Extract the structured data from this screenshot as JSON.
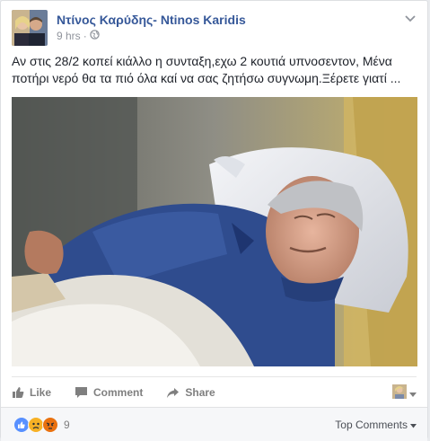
{
  "post": {
    "author": "Ντίνος Καρύδης- Ntinos Karidis",
    "time": "9 hrs",
    "time_separator": "·",
    "privacy_icon": "globe-icon",
    "text": "Αν στις 28/2 κοπεί κιάλλο η συνταξη,εχω 2 κουτιά υπνοσεντον, Μένα ποτήρι νερό θα τα πιό όλα καί να σας ζητήσω συγνωμη.Ξέρετε γιατί ..."
  },
  "actions": {
    "like": "Like",
    "comment": "Comment",
    "share": "Share"
  },
  "reactions": {
    "count": "9",
    "icons": [
      "like-icon",
      "sad-icon",
      "angry-icon"
    ]
  },
  "comments": {
    "sort_label": "Top Comments"
  },
  "colors": {
    "link": "#365899",
    "text": "#1d2129",
    "muted": "#90949c",
    "like_blue": "#5890ff",
    "sad_yellow": "#f7b125",
    "angry_red": "#e9710f"
  }
}
